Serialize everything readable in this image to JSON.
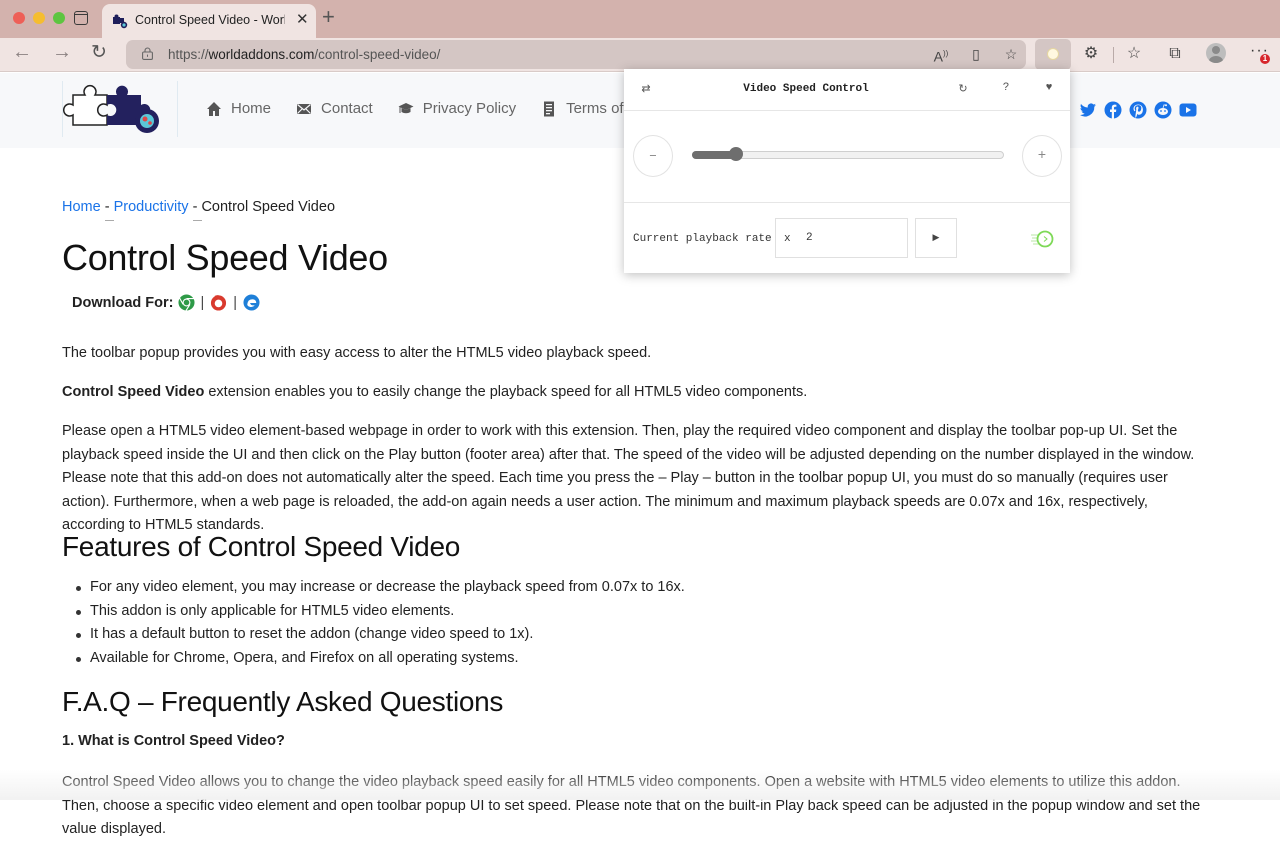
{
  "browser": {
    "tab_title": "Control Speed Video - WorldAddons",
    "url_prefix": "https://",
    "url_domain": "worldaddons.com",
    "url_path": "/control-speed-video/",
    "notification_count": "1",
    "icons": [
      "back-icon",
      "forward-icon",
      "reload-icon",
      "lock-icon",
      "read-aloud-icon",
      "immersive-reader-icon",
      "add-favorite-icon",
      "extension-video-speed-icon",
      "extensions-icon",
      "favorites-icon",
      "collections-icon",
      "profile-icon",
      "more-icon"
    ]
  },
  "site": {
    "menu": [
      {
        "label": "Home",
        "icon": "home-icon"
      },
      {
        "label": "Contact",
        "icon": "envelope-icon"
      },
      {
        "label": "Privacy Policy",
        "icon": "graduation-cap-icon"
      },
      {
        "label": "Terms of",
        "icon": "document-icon"
      }
    ],
    "social": [
      "twitter-icon",
      "facebook-icon",
      "pinterest-icon",
      "reddit-icon",
      "youtube-icon"
    ],
    "colors": {
      "social": "#1a73e8",
      "link": "#1a73e8"
    }
  },
  "content": {
    "breadcrumb": {
      "home": "Home",
      "sep": "-",
      "category": "Productivity",
      "current": "Control Speed Video"
    },
    "title": "Control Speed Video",
    "download_label": "Download For:",
    "download_sep": "|",
    "intro": "The toolbar popup provides you with easy access to alter the HTML5 video playback speed.",
    "p2_bold": "Control Speed Video",
    "p2_rest": " extension enables you to easily change the playback speed for all HTML5 video components.",
    "p3": "Please open a HTML5 video element-based webpage in order to work with this extension. Then, play the required video component and display the toolbar pop-up UI. Set the playback speed inside the UI and then click on the Play button (footer area) after that. The speed of the video will be adjusted depending on the number displayed in the window. Please note that this add-on does not automatically alter the speed. Each time you press the – Play – button in the toolbar popup UI, you must do so manually (requires user action). Furthermore, when a web page is reloaded, the add-on again needs a user action. The minimum and maximum playback speeds are 0.07x and 16x, respectively, according to HTML5 standards.",
    "features_heading": "Features of Control Speed Video",
    "features": [
      "For any video element, you may increase or decrease the playback speed from 0.07x to 16x.",
      "This addon is only applicable for HTML5 video elements.",
      "It has a default button to reset the addon (change video speed to 1x).",
      "Available for Chrome, Opera, and Firefox on all operating systems."
    ],
    "faq_heading": "F.A.Q – Frequently Asked Questions",
    "q1": "1. What is Control Speed Video?",
    "a1": "Control Speed Video allows you to change the video playback speed easily for all HTML5 video components. Open a website with HTML5 video elements to utilize this addon. Then, choose a specific video element and open toolbar popup UI to set speed. Please note that on the built-in Play back speed can be adjusted in the popup window and set the value displayed."
  },
  "popup": {
    "title": "Video Speed Control",
    "minus_label": "–",
    "plus_label": "+",
    "slider_fraction": 0.14,
    "rate_label": "Current playback rate",
    "rate_prefix": "x",
    "rate_value": "2",
    "play_label": "▶",
    "accent": "#7ed957"
  }
}
